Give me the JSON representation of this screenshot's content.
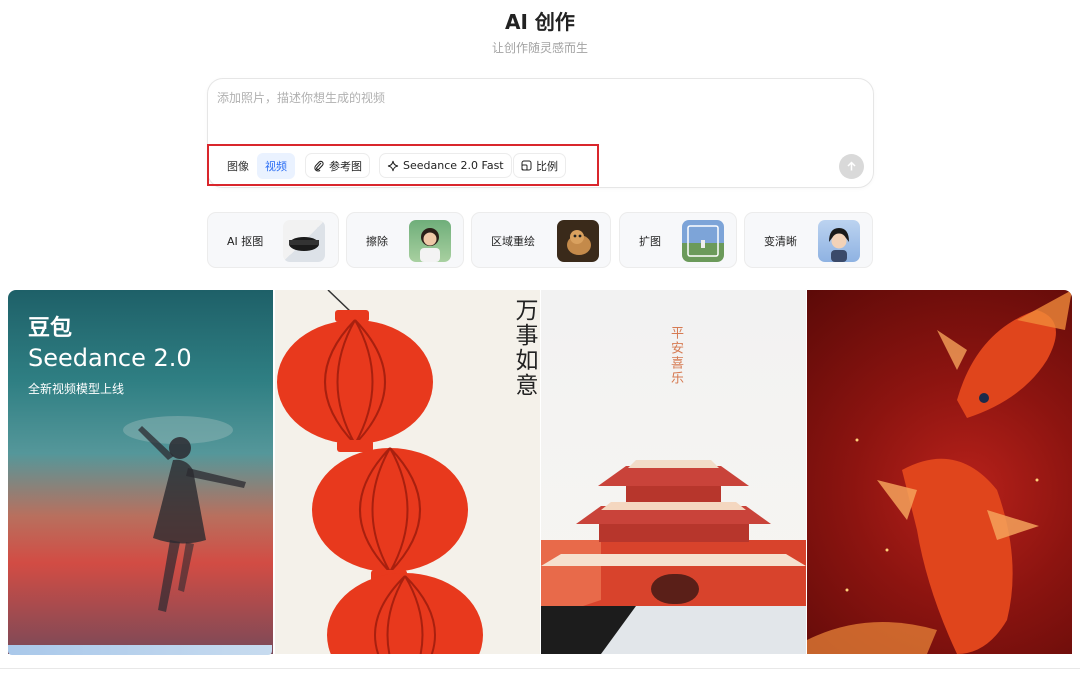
{
  "header": {
    "title": "AI 创作",
    "subtitle": "让创作随灵感而生"
  },
  "composer": {
    "placeholder": "添加照片，描述你想生成的视频",
    "mode_image": "图像",
    "mode_video": "视频",
    "active_mode": "视频",
    "reference_label": "参考图",
    "model_label": "Seedance 2.0 Fast",
    "ratio_label": "比例"
  },
  "tools": [
    {
      "label": "AI 抠图",
      "icon": "cutout-thumbnail"
    },
    {
      "label": "擦除",
      "icon": "erase-thumbnail"
    },
    {
      "label": "区域重绘",
      "icon": "repaint-thumbnail"
    },
    {
      "label": "扩图",
      "icon": "expand-thumbnail"
    },
    {
      "label": "变清晰",
      "icon": "enhance-thumbnail"
    }
  ],
  "gallery": {
    "card1": {
      "brand": "豆包",
      "model": "Seedance 2.0",
      "tagline": "全新视频模型上线"
    },
    "card2": {
      "text": "万事如意"
    },
    "card3": {
      "text": "平安喜乐"
    }
  },
  "colors": {
    "accent": "#2a6df4",
    "highlight_box": "#d9262c",
    "lantern_red": "#e8391d"
  }
}
